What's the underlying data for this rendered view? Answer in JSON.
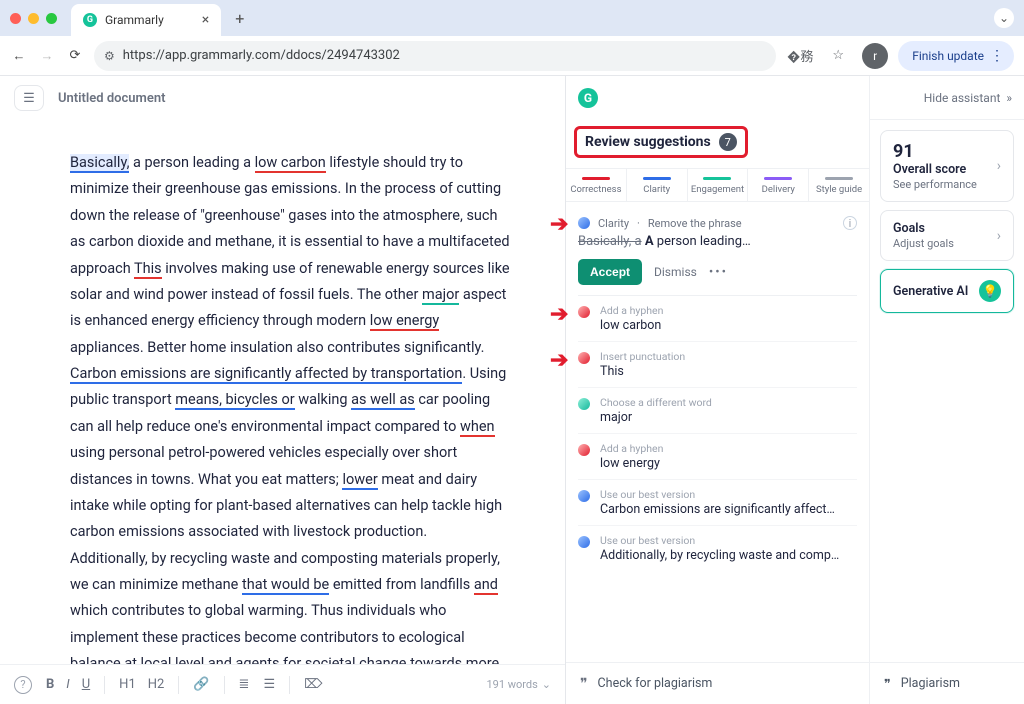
{
  "browser": {
    "tab_title": "Grammarly",
    "url": "https://app.grammarly.com/ddocs/2494743302",
    "finish_update": "Finish update"
  },
  "doc": {
    "title": "Untitled document",
    "para1_a": "Basically,",
    "para1_b": " a person leading a ",
    "para1_c": "low carbon",
    "para1_d": " lifestyle should try to minimize their greenhouse gas emissions. In the process of cutting down the release of \"greenhouse\" gases into the atmosphere, such as carbon dioxide and methane, it is essential to have a multifaceted approach ",
    "para1_e": "This",
    "para1_f": " involves making use of renewable energy sources like solar and wind power instead of fossil fuels. The other ",
    "para1_g": "major",
    "para1_h": " aspect is enhanced energy efficiency through modern ",
    "para1_i": "low energy",
    "para1_j": " appliances. Better home insulation also contributes significantly.",
    "para2_a": "Carbon emissions are significantly affected by transportation",
    "para2_b": ". Using public transport ",
    "para2_c": "means, bicycles or",
    "para2_d": " walking ",
    "para2_e": "as well as",
    "para2_f": " car pooling can all help reduce one's environmental impact compared to ",
    "para2_g": "when",
    "para2_h": " using personal petrol-powered vehicles especially over short distances in towns. What you eat matters; ",
    "para2_i": "lower",
    "para2_j": " meat and dairy intake while opting for plant-based alternatives can help tackle high carbon emissions associated with livestock production.",
    "para3_a": "Additionally, by recycling waste and composting materials properly, we can minimize methane ",
    "para3_b": "that would be",
    "para3_c": " emitted from landfills ",
    "para3_d": "and",
    "para3_e": " which contributes to global warming. Thus individuals who implement these practices become contributors to ecological balance at local level and agents for societal change towards more environmentally friendly lifestyles.",
    "wordcount": "191 words"
  },
  "format": {
    "b": "B",
    "i": "I",
    "u": "U",
    "h1": "H1",
    "h2": "H2"
  },
  "panel": {
    "review_label": "Review suggestions",
    "review_count": "7",
    "cats": {
      "correctness": "Correctness",
      "clarity": "Clarity",
      "engagement": "Engagement",
      "delivery": "Delivery",
      "style": "Style guide"
    },
    "card1": {
      "category": "Clarity",
      "hint": "Remove the phrase",
      "strike": "Basically, a",
      "bold": "A",
      "rest": " person leading…",
      "accept": "Accept",
      "dismiss": "Dismiss"
    },
    "s2": {
      "lbl": "Add a hyphen",
      "txt": "low carbon"
    },
    "s3": {
      "lbl": "Insert punctuation",
      "txt": "This"
    },
    "s4": {
      "lbl": "Choose a different word",
      "txt": "major"
    },
    "s5": {
      "lbl": "Add a hyphen",
      "txt": "low energy"
    },
    "s6": {
      "lbl": "Use our best version",
      "txt": "Carbon emissions are significantly affected by…"
    },
    "s7": {
      "lbl": "Use our best version",
      "txt": "Additionally, by recycling waste and composting…"
    },
    "plagiarism": "Check for plagiarism"
  },
  "right": {
    "hide": "Hide assistant",
    "score_num": "91",
    "score_lbl": "Overall score",
    "score_sub": "See performance",
    "goals_lbl": "Goals",
    "goals_sub": "Adjust goals",
    "gen_lbl": "Generative AI",
    "plag_lbl": "Plagiarism"
  }
}
